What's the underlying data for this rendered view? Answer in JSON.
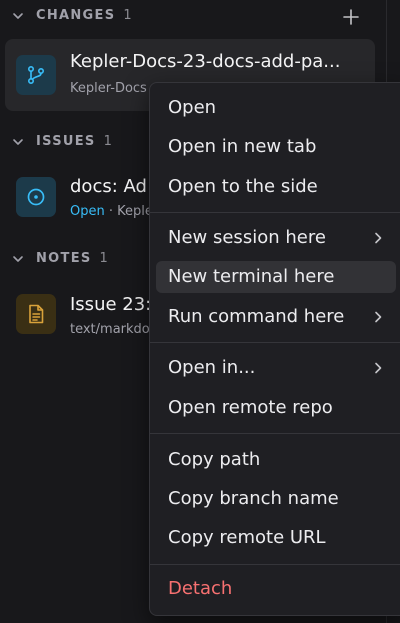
{
  "sections": {
    "changes": {
      "title": "CHANGES",
      "count": "1"
    },
    "issues": {
      "title": "ISSUES",
      "count": "1"
    },
    "notes": {
      "title": "NOTES",
      "count": "1"
    }
  },
  "changes_item": {
    "title": "Kepler-Docs-23-docs-add-pa...",
    "subtitle": "Kepler-Docs",
    "icon": "git-branch-icon"
  },
  "issues_item": {
    "title": "docs: Ad",
    "status": "Open",
    "subtitle_rest": " · Keple",
    "icon": "issue-circle-icon"
  },
  "notes_item": {
    "title": "Issue 23:",
    "subtitle": "text/markdo",
    "icon": "document-icon"
  },
  "context_menu": {
    "open": "Open",
    "open_new_tab": "Open in new tab",
    "open_side": "Open to the side",
    "new_session": "New session here",
    "new_terminal": "New terminal here",
    "run_command": "Run command here",
    "open_in": "Open in...",
    "open_remote_repo": "Open remote repo",
    "copy_path": "Copy path",
    "copy_branch": "Copy branch name",
    "copy_remote_url": "Copy remote URL",
    "detach": "Detach"
  },
  "colors": {
    "background": "#18181b",
    "accent_blue": "#38bdf8",
    "danger": "#f87171",
    "note_amber": "#d9a23a"
  }
}
